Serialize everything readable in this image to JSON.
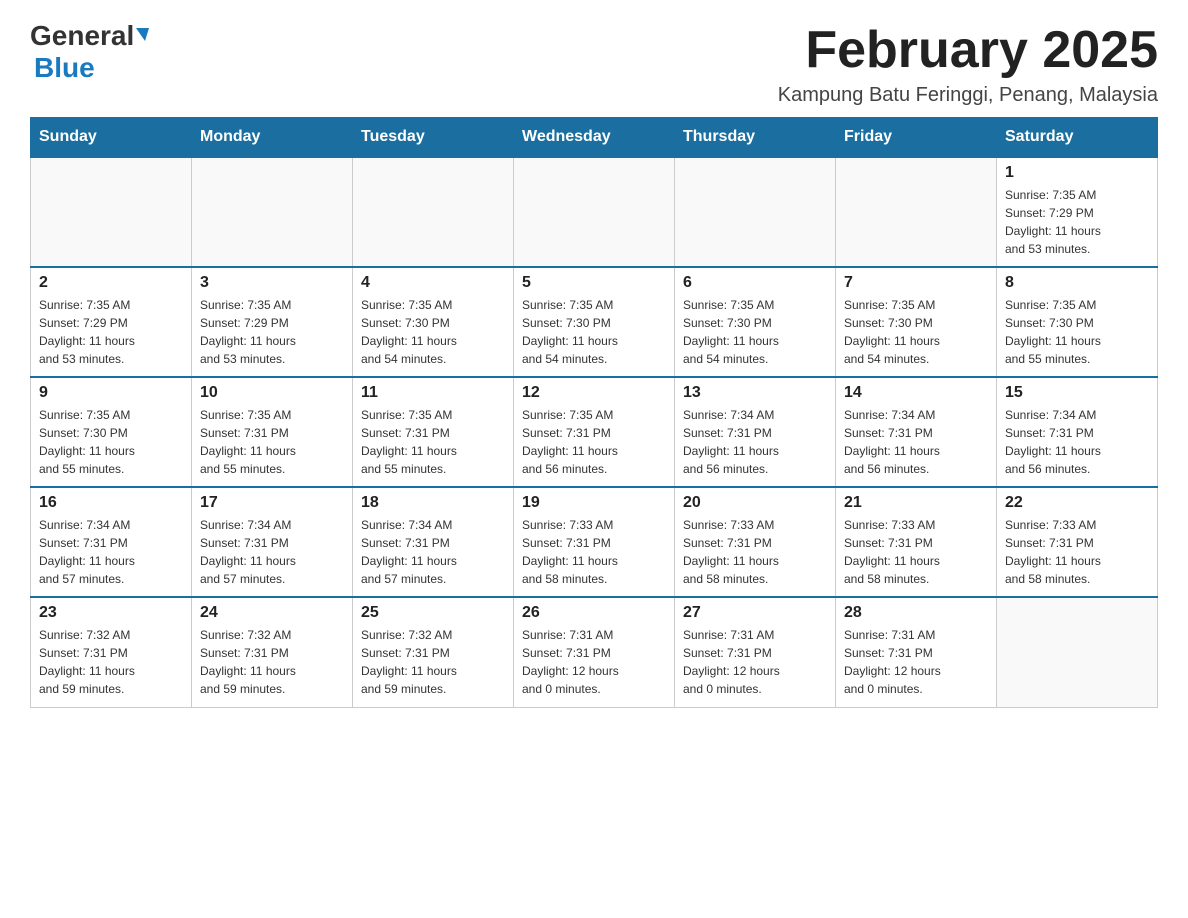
{
  "logo": {
    "general": "General",
    "arrow_char": "▶",
    "blue": "Blue"
  },
  "header": {
    "title": "February 2025",
    "subtitle": "Kampung Batu Feringgi, Penang, Malaysia"
  },
  "weekdays": [
    "Sunday",
    "Monday",
    "Tuesday",
    "Wednesday",
    "Thursday",
    "Friday",
    "Saturday"
  ],
  "weeks": [
    [
      {
        "day": "",
        "info": ""
      },
      {
        "day": "",
        "info": ""
      },
      {
        "day": "",
        "info": ""
      },
      {
        "day": "",
        "info": ""
      },
      {
        "day": "",
        "info": ""
      },
      {
        "day": "",
        "info": ""
      },
      {
        "day": "1",
        "info": "Sunrise: 7:35 AM\nSunset: 7:29 PM\nDaylight: 11 hours\nand 53 minutes."
      }
    ],
    [
      {
        "day": "2",
        "info": "Sunrise: 7:35 AM\nSunset: 7:29 PM\nDaylight: 11 hours\nand 53 minutes."
      },
      {
        "day": "3",
        "info": "Sunrise: 7:35 AM\nSunset: 7:29 PM\nDaylight: 11 hours\nand 53 minutes."
      },
      {
        "day": "4",
        "info": "Sunrise: 7:35 AM\nSunset: 7:30 PM\nDaylight: 11 hours\nand 54 minutes."
      },
      {
        "day": "5",
        "info": "Sunrise: 7:35 AM\nSunset: 7:30 PM\nDaylight: 11 hours\nand 54 minutes."
      },
      {
        "day": "6",
        "info": "Sunrise: 7:35 AM\nSunset: 7:30 PM\nDaylight: 11 hours\nand 54 minutes."
      },
      {
        "day": "7",
        "info": "Sunrise: 7:35 AM\nSunset: 7:30 PM\nDaylight: 11 hours\nand 54 minutes."
      },
      {
        "day": "8",
        "info": "Sunrise: 7:35 AM\nSunset: 7:30 PM\nDaylight: 11 hours\nand 55 minutes."
      }
    ],
    [
      {
        "day": "9",
        "info": "Sunrise: 7:35 AM\nSunset: 7:30 PM\nDaylight: 11 hours\nand 55 minutes."
      },
      {
        "day": "10",
        "info": "Sunrise: 7:35 AM\nSunset: 7:31 PM\nDaylight: 11 hours\nand 55 minutes."
      },
      {
        "day": "11",
        "info": "Sunrise: 7:35 AM\nSunset: 7:31 PM\nDaylight: 11 hours\nand 55 minutes."
      },
      {
        "day": "12",
        "info": "Sunrise: 7:35 AM\nSunset: 7:31 PM\nDaylight: 11 hours\nand 56 minutes."
      },
      {
        "day": "13",
        "info": "Sunrise: 7:34 AM\nSunset: 7:31 PM\nDaylight: 11 hours\nand 56 minutes."
      },
      {
        "day": "14",
        "info": "Sunrise: 7:34 AM\nSunset: 7:31 PM\nDaylight: 11 hours\nand 56 minutes."
      },
      {
        "day": "15",
        "info": "Sunrise: 7:34 AM\nSunset: 7:31 PM\nDaylight: 11 hours\nand 56 minutes."
      }
    ],
    [
      {
        "day": "16",
        "info": "Sunrise: 7:34 AM\nSunset: 7:31 PM\nDaylight: 11 hours\nand 57 minutes."
      },
      {
        "day": "17",
        "info": "Sunrise: 7:34 AM\nSunset: 7:31 PM\nDaylight: 11 hours\nand 57 minutes."
      },
      {
        "day": "18",
        "info": "Sunrise: 7:34 AM\nSunset: 7:31 PM\nDaylight: 11 hours\nand 57 minutes."
      },
      {
        "day": "19",
        "info": "Sunrise: 7:33 AM\nSunset: 7:31 PM\nDaylight: 11 hours\nand 58 minutes."
      },
      {
        "day": "20",
        "info": "Sunrise: 7:33 AM\nSunset: 7:31 PM\nDaylight: 11 hours\nand 58 minutes."
      },
      {
        "day": "21",
        "info": "Sunrise: 7:33 AM\nSunset: 7:31 PM\nDaylight: 11 hours\nand 58 minutes."
      },
      {
        "day": "22",
        "info": "Sunrise: 7:33 AM\nSunset: 7:31 PM\nDaylight: 11 hours\nand 58 minutes."
      }
    ],
    [
      {
        "day": "23",
        "info": "Sunrise: 7:32 AM\nSunset: 7:31 PM\nDaylight: 11 hours\nand 59 minutes."
      },
      {
        "day": "24",
        "info": "Sunrise: 7:32 AM\nSunset: 7:31 PM\nDaylight: 11 hours\nand 59 minutes."
      },
      {
        "day": "25",
        "info": "Sunrise: 7:32 AM\nSunset: 7:31 PM\nDaylight: 11 hours\nand 59 minutes."
      },
      {
        "day": "26",
        "info": "Sunrise: 7:31 AM\nSunset: 7:31 PM\nDaylight: 12 hours\nand 0 minutes."
      },
      {
        "day": "27",
        "info": "Sunrise: 7:31 AM\nSunset: 7:31 PM\nDaylight: 12 hours\nand 0 minutes."
      },
      {
        "day": "28",
        "info": "Sunrise: 7:31 AM\nSunset: 7:31 PM\nDaylight: 12 hours\nand 0 minutes."
      },
      {
        "day": "",
        "info": ""
      }
    ]
  ]
}
